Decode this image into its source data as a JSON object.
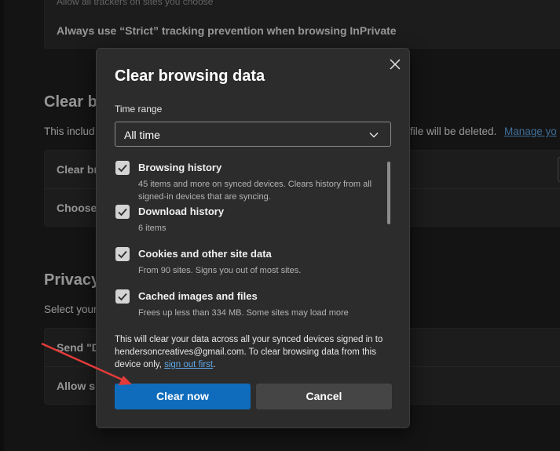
{
  "background": {
    "tracking_sub": "Allow all trackers on sites you choose",
    "inprivate_row": "Always use “Strict” tracking prevention when browsing InPrivate",
    "clear_heading": "Clear br",
    "clear_desc_start": "This includ",
    "clear_desc_end": "file will be deleted.",
    "manage_link": "Manage yo",
    "clear_row_1": "Clear br",
    "clear_row_2": "Choose",
    "privacy_heading": "Privacy",
    "privacy_desc": "Select your",
    "privacy_row_1": "Send \"D",
    "privacy_row_2": "Allow si"
  },
  "dialog": {
    "title": "Clear browsing data",
    "close_icon": "close-icon",
    "time_range_label": "Time range",
    "time_range_value": "All time",
    "items": [
      {
        "title": "Browsing history",
        "desc": "45 items and more on synced devices. Clears history from all signed-in devices that are syncing.",
        "checked": true
      },
      {
        "title": "Download history",
        "desc": "6 items",
        "checked": true
      },
      {
        "title": "Cookies and other site data",
        "desc": "From 90 sites. Signs you out of most sites.",
        "checked": true
      },
      {
        "title": "Cached images and files",
        "desc": "Frees up less than 334 MB. Some sites may load more",
        "checked": true
      }
    ],
    "notice_text": "This will clear your data across all your synced devices signed in to hendersoncreatives@gmail.com. To clear browsing data from this device only,",
    "notice_link": "sign out first",
    "notice_end": ".",
    "clear_button": "Clear now",
    "cancel_button": "Cancel"
  },
  "colors": {
    "accent": "#0f6cbd",
    "link": "#5fa8e8",
    "annotation_arrow": "#e23a3a"
  }
}
